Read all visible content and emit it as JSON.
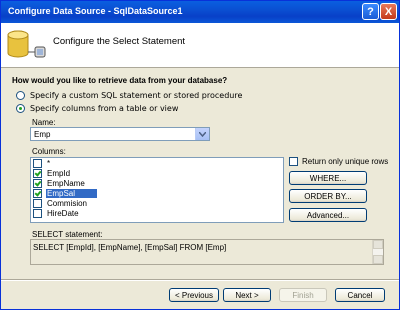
{
  "window": {
    "title": "Configure Data Source - SqlDataSource1",
    "help_label": "?",
    "close_label": "X"
  },
  "header": {
    "title": "Configure the Select Statement",
    "icon": "database-icon"
  },
  "question": "How would you like to retrieve data from your database?",
  "options": [
    {
      "label": "Specify a custom SQL statement or stored procedure",
      "selected": false
    },
    {
      "label": "Specify columns from a table or view",
      "selected": true
    }
  ],
  "name_field": {
    "label": "Name:",
    "value": "Emp"
  },
  "columns": {
    "label": "Columns:",
    "items": [
      {
        "name": "*",
        "checked": false,
        "selected": false
      },
      {
        "name": "EmpId",
        "checked": true,
        "selected": false
      },
      {
        "name": "EmpName",
        "checked": true,
        "selected": false
      },
      {
        "name": "EmpSal",
        "checked": true,
        "selected": true
      },
      {
        "name": "Commision",
        "checked": false,
        "selected": false
      },
      {
        "name": "HireDate",
        "checked": false,
        "selected": false
      }
    ]
  },
  "unique_rows": {
    "label": "Return only unique rows",
    "checked": false
  },
  "side_buttons": {
    "where": "WHERE...",
    "order_by": "ORDER BY...",
    "advanced": "Advanced..."
  },
  "sql": {
    "label": "SELECT statement:",
    "text": "SELECT [EmpId], [EmpName], [EmpSal] FROM [Emp]"
  },
  "footer": {
    "previous": "< Previous",
    "next": "Next >",
    "finish": "Finish",
    "cancel": "Cancel"
  }
}
